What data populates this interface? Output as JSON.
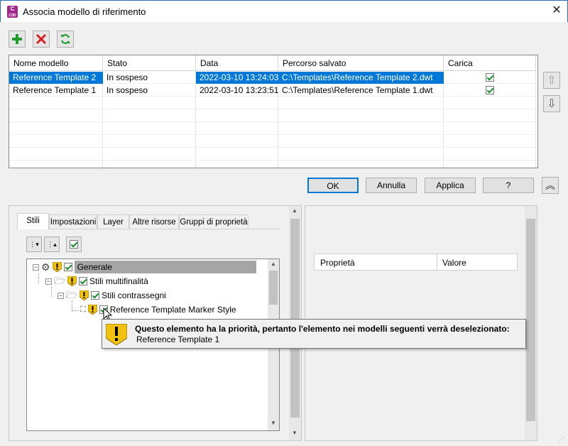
{
  "window": {
    "title": "Associa modello di riferimento",
    "app_icon_text": "C",
    "app_icon_sub": "C3D"
  },
  "grid": {
    "columns": [
      "Nome modello",
      "Stato",
      "Data",
      "Percorso salvato",
      "Carica"
    ],
    "rows": [
      {
        "name": "Reference Template 2",
        "status": "In sospeso",
        "date": "2022-03-10 13:24:03",
        "path": "C:\\Templates\\Reference Template 2.dwt",
        "load": true,
        "selected": true
      },
      {
        "name": "Reference Template 1",
        "status": "In sospeso",
        "date": "2022-03-10 13:23:51",
        "path": "C:\\Templates\\Reference Template 1.dwt",
        "load": true,
        "selected": false
      }
    ]
  },
  "buttons": {
    "ok": "OK",
    "cancel": "Annulla",
    "apply": "Applica",
    "help": "?"
  },
  "tabs": [
    "Stili",
    "Impostazioni",
    "Layer",
    "Altre risorse",
    "Gruppi di proprietà"
  ],
  "tree": {
    "root": "Generale",
    "child1": "Stili multifinalità",
    "child2": "Stili contrassegni",
    "child3": "Reference Template Marker Style"
  },
  "tooltip": {
    "title": "Questo elemento ha la priorità, pertanto l'elemento nei modelli seguenti verrà deselezionato:",
    "item": "Reference Template 1"
  },
  "properties": {
    "columns": [
      "Proprietà",
      "Valore"
    ]
  },
  "colors": {
    "selection": "#0078d7",
    "add": "#1f9a2f",
    "delete": "#d42020",
    "warning": "#f2c10f"
  }
}
